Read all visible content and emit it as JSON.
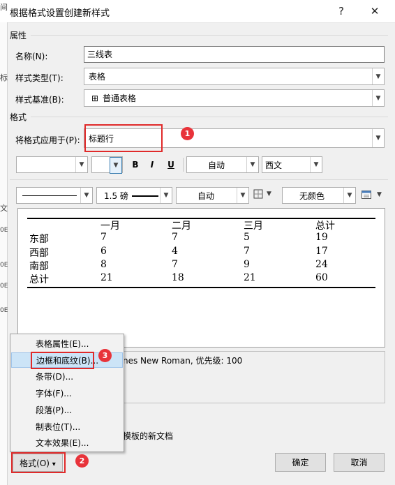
{
  "window": {
    "title": "根据格式设置创建新样式",
    "help_glyph": "?",
    "close_glyph": "✕"
  },
  "edge_chars": [
    "间",
    "标",
    "文",
    "0E",
    "0E",
    "0E",
    "0E"
  ],
  "properties": {
    "section_title": "属性",
    "name_label": "名称(N):",
    "name_value": "三线表",
    "type_label": "样式类型(T):",
    "type_value": "表格",
    "base_label": "样式基准(B):",
    "base_value": "普通表格",
    "base_icon_glyph": "⊞"
  },
  "format": {
    "section_title": "格式",
    "apply_label": "将格式应用于(P):",
    "apply_value": "标题行",
    "font_name_value": "",
    "font_size_value": "",
    "bold_label": "B",
    "italic_label": "I",
    "underline_label": "U",
    "font_color_value": "自动",
    "script_value": "西文",
    "border_weight_value": "1.5 磅",
    "border_color_value": "自动",
    "shading_value": "无颜色"
  },
  "preview_table": {
    "headers": [
      "",
      "一月",
      "二月",
      "三月",
      "总计"
    ],
    "rows": [
      [
        "东部",
        "7",
        "7",
        "5",
        "19"
      ],
      [
        "西部",
        "6",
        "4",
        "7",
        "17"
      ],
      [
        "南部",
        "8",
        "7",
        "9",
        "24"
      ],
      [
        "总计",
        "21",
        "18",
        "21",
        "60"
      ]
    ]
  },
  "description_text": "nes New Roman, 优先级: 100",
  "template_option_text": "模板的新文档",
  "format_menu": {
    "items": [
      "表格属性(E)...",
      "边框和底纹(B)...",
      "条带(D)...",
      "字体(F)...",
      "段落(P)...",
      "制表位(T)...",
      "文本效果(E)..."
    ],
    "selected_index": 1
  },
  "buttons": {
    "format": "格式(O)",
    "format_arrow": "▾",
    "ok": "确定",
    "cancel": "取消"
  },
  "callouts": [
    "1",
    "2",
    "3"
  ],
  "colors": {
    "callout_red": "#e8333a",
    "highlight_box_red": "#e02a2a",
    "menu_selected_bg": "#cce4f7"
  }
}
